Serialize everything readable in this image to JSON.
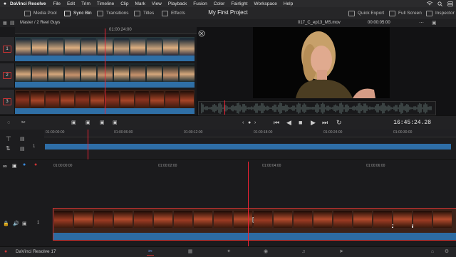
{
  "menubar": {
    "app": "DaVinci Resolve",
    "items": [
      "File",
      "Edit",
      "Trim",
      "Timeline",
      "Clip",
      "Mark",
      "View",
      "Playback",
      "Fusion",
      "Color",
      "Fairlight",
      "Workspace",
      "Help"
    ],
    "icons": [
      "wifi-icon",
      "search-icon",
      "control-icon"
    ]
  },
  "toolbar": {
    "media_pool": "Media Pool",
    "sync_bin": "Sync Bin",
    "transitions": "Transitions",
    "titles": "Titles",
    "effects": "Effects",
    "project_title": "My First Project",
    "quick_export": "Quick Export",
    "full_screen": "Full Screen",
    "inspector": "Inspector"
  },
  "subbar": {
    "breadcrumb": "Master / 2 Reel Guys",
    "clip_name": "017_C_ep13_MS.mov",
    "clip_duration": "00:00:05:00"
  },
  "source_tape": {
    "timecode": "01:00:24:00",
    "tracks": [
      "1",
      "2",
      "3"
    ]
  },
  "transport": {
    "timecode": "16:45:24.28"
  },
  "upper_timeline": {
    "ruler": [
      "01:00:00:00",
      "01:00:06:00",
      "01:00:12:00",
      "01:00:18:00",
      "01:00:24:00",
      "01:00:30:00"
    ],
    "track": "1"
  },
  "lower_timeline": {
    "ruler": [
      "01:00:00:00",
      "01:00:02:00",
      "01:00:04:00",
      "01:00:06:00"
    ],
    "track": "1",
    "watermark_bold": "LARRYJORDAN",
    "watermark_suffix": ".com"
  },
  "bottombar": {
    "app_version": "DaVinci Resolve 17"
  },
  "colors": {
    "accent": "#e32222",
    "audio": "#2e6ea7"
  }
}
